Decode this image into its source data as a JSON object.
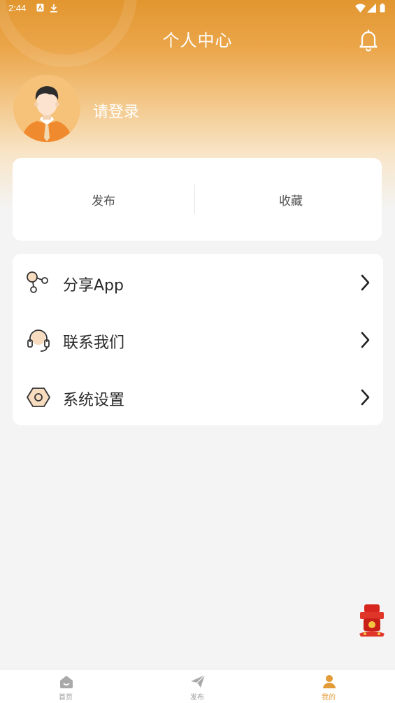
{
  "status_bar": {
    "time": "2:44"
  },
  "header": {
    "title": "个人中心"
  },
  "profile": {
    "login_prompt": "请登录"
  },
  "stats": [
    {
      "label": "发布"
    },
    {
      "label": "收藏"
    }
  ],
  "menu": {
    "items": [
      {
        "label": "分享App",
        "icon": "share-icon"
      },
      {
        "label": "联系我们",
        "icon": "headset-icon"
      },
      {
        "label": "系统设置",
        "icon": "settings-hex-icon"
      }
    ]
  },
  "tabbar": {
    "items": [
      {
        "label": "首页",
        "icon": "home-icon",
        "active": false
      },
      {
        "label": "发布",
        "icon": "paper-plane-icon",
        "active": false
      },
      {
        "label": "我的",
        "icon": "user-icon",
        "active": true
      }
    ]
  },
  "colors": {
    "accent": "#e39b37",
    "header_top": "#e2962f",
    "background": "#f4f4f4"
  }
}
